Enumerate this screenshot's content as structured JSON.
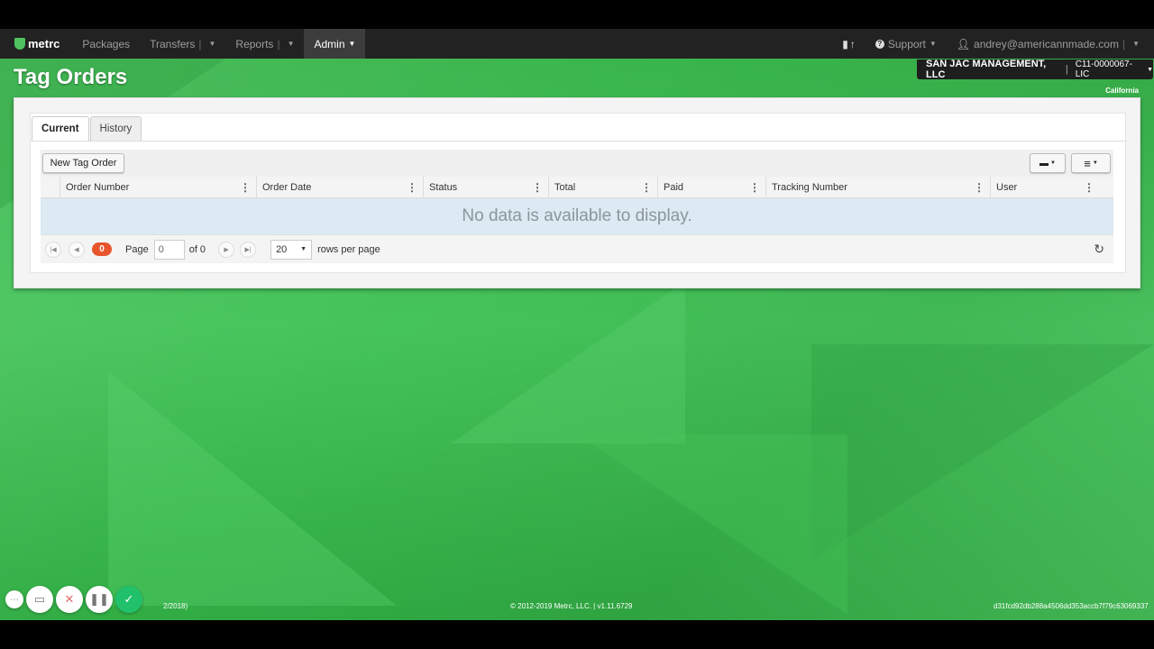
{
  "navbar": {
    "brand": "metrc",
    "items": [
      {
        "label": "Packages",
        "has_caret": false
      },
      {
        "label": "Transfers",
        "has_caret": true
      },
      {
        "label": "Reports",
        "has_caret": true
      },
      {
        "label": "Admin",
        "has_caret": true,
        "active": true
      }
    ],
    "support_label": "Support",
    "user_email": "andrey@americannmade.com"
  },
  "license": {
    "org": "SAN JAC MANAGEMENT, LLC",
    "number": "C11-0000067-LIC",
    "state": "California"
  },
  "page": {
    "title": "Tag Orders"
  },
  "tabs": [
    {
      "label": "Current",
      "active": true
    },
    {
      "label": "History",
      "active": false
    }
  ],
  "toolbar": {
    "new_order_label": "New Tag Order"
  },
  "grid": {
    "columns": [
      "Order Number",
      "Order Date",
      "Status",
      "Total",
      "Paid",
      "Tracking Number",
      "User"
    ],
    "empty_message": "No data is available to display."
  },
  "pager": {
    "count_badge": "0",
    "page_label": "Page",
    "page_value": "0",
    "of_label": "of 0",
    "rows_per_page_value": "20",
    "rows_per_page_label": "rows per page"
  },
  "footer": {
    "copyright": "© 2012-2019 Metrc, LLC. | v1.11.6729",
    "hash": "d31fcd92db288a4506dd353accb7f79c63069337",
    "left_partial": "2/2018)"
  },
  "colors": {
    "navbar": "#222222",
    "accent_green": "#3cb54f",
    "badge": "#e8552d",
    "empty_row": "#dbeaf3"
  }
}
